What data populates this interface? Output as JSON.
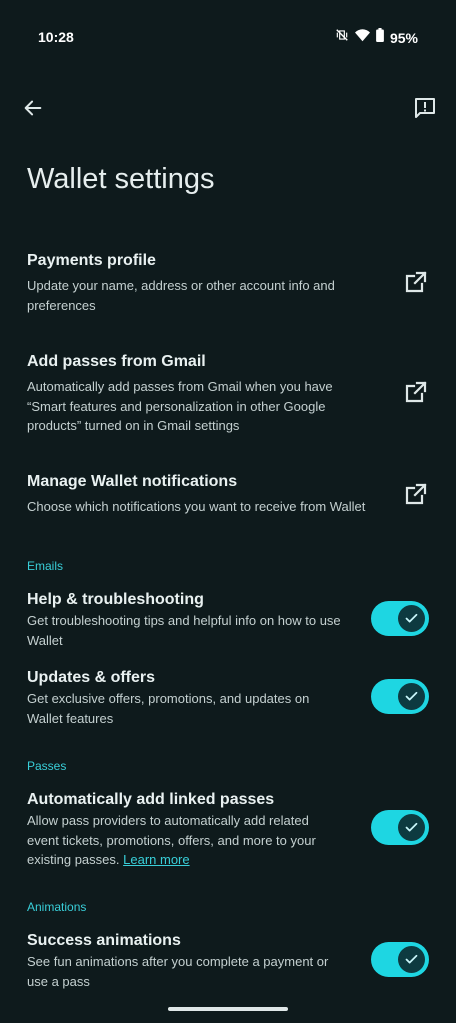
{
  "status": {
    "time": "10:28",
    "battery": "95%"
  },
  "header": {
    "title": "Wallet settings"
  },
  "links": [
    {
      "title": "Payments profile",
      "desc": "Update your name, address or other account info and preferences"
    },
    {
      "title": "Add passes from Gmail",
      "desc": "Automatically add passes from Gmail when you have “Smart features and personalization in other Google products” turned on in Gmail settings"
    },
    {
      "title": "Manage Wallet notifications",
      "desc": "Choose which notifications you want to receive from Wallet"
    }
  ],
  "sections": {
    "emails": "Emails",
    "passes": "Passes",
    "animations": "Animations"
  },
  "toggles": {
    "help": {
      "title": "Help & troubleshooting",
      "desc": "Get troubleshooting tips and helpful info on how to use Wallet",
      "on": true
    },
    "updates": {
      "title": "Updates & offers",
      "desc": "Get exclusive offers, promotions, and updates on Wallet features",
      "on": true
    },
    "linked": {
      "title": "Automatically add linked passes",
      "desc": "Allow pass providers to automatically add related event tickets, promotions, offers, and more to your existing passes.",
      "link": "Learn more",
      "on": true
    },
    "success": {
      "title": "Success animations",
      "desc": "See fun animations after you complete a payment or use a pass",
      "on": true
    }
  },
  "colors": {
    "background": "#0e1a1c",
    "accent": "#39cfd9",
    "toggle_track": "#1ed6e2",
    "toggle_knob": "#0d3a40"
  }
}
